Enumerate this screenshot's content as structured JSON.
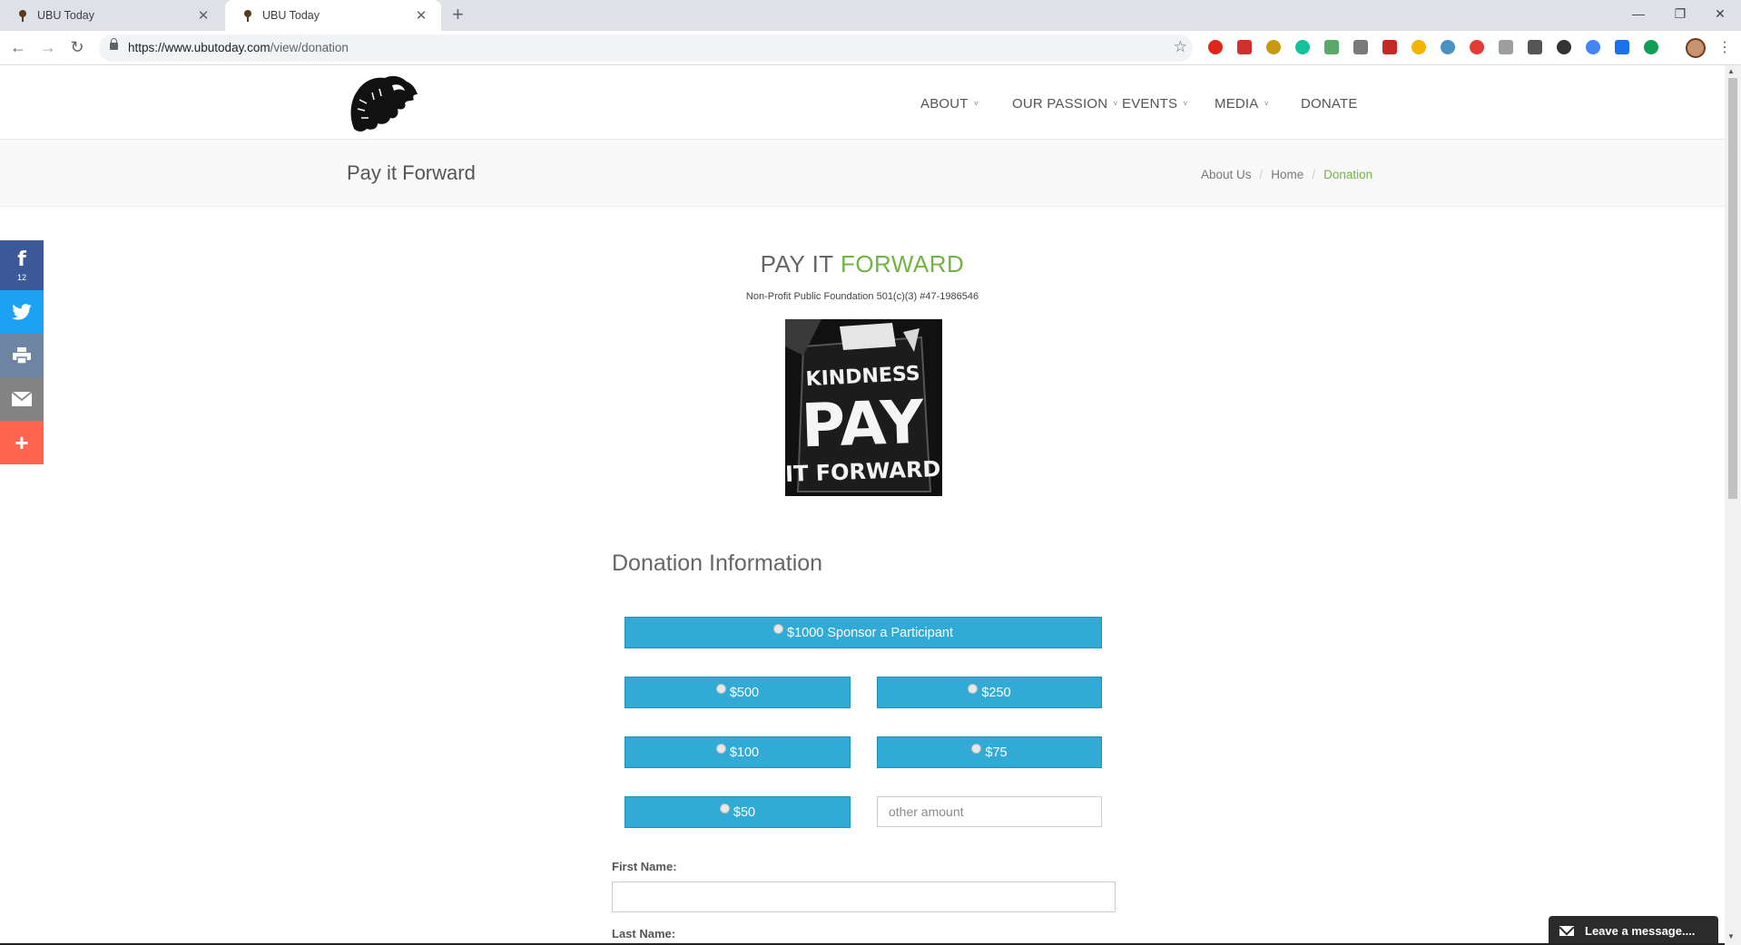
{
  "browser": {
    "tabs": [
      {
        "title": "UBU Today",
        "close": "✕"
      },
      {
        "title": "UBU Today",
        "close": "✕"
      }
    ],
    "new_tab": "+",
    "url_host": "https://www.ubutoday.com",
    "url_path": "/view/donation",
    "window_controls": {
      "minimize": "—",
      "restore": "❐",
      "close": "✕"
    }
  },
  "nav": {
    "items": [
      "ABOUT",
      "OUR PASSION",
      "EVENTS",
      "MEDIA",
      "DONATE"
    ],
    "chevron": "˅"
  },
  "page": {
    "title": "Pay it Forward",
    "breadcrumbs": [
      "About Us",
      "Home",
      "Donation"
    ],
    "breadcrumb_sep": "/"
  },
  "social": {
    "facebook_count": "12",
    "more_label": "+"
  },
  "main": {
    "headline_part1": "PAY IT ",
    "headline_part2": "FORWARD",
    "taxline": "Non-Profit Public Foundation 501(c)(3) #47-1986546",
    "hero_text": [
      "KINDNESS",
      "PAY",
      "IT FORWARD"
    ],
    "section_title": "Donation Information"
  },
  "donation": {
    "options": [
      "$1000 Sponsor a Participant",
      "$500",
      "$250",
      "$100",
      "$75",
      "$50"
    ],
    "other_placeholder": "other amount"
  },
  "form": {
    "first_name_label": "First Name:",
    "last_name_label": "Last Name:"
  },
  "chat": {
    "label": "Leave a message...."
  },
  "colors": {
    "accent_green": "#70b544",
    "button_blue": "#31abd6",
    "facebook": "#3b5998",
    "twitter": "#1da1f2",
    "print": "#6d84a3",
    "email": "#848484",
    "more": "#ff6550"
  }
}
